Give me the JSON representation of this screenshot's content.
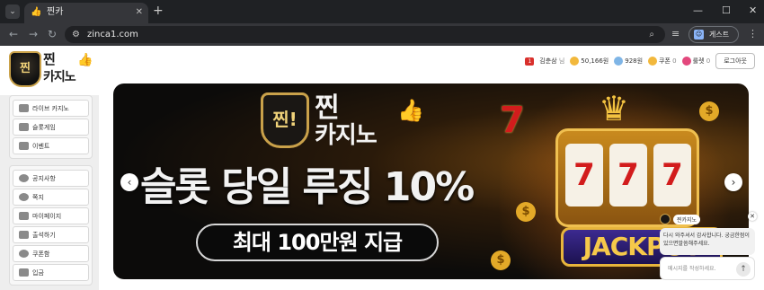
{
  "browser": {
    "tab_title": "찐카",
    "tab_menu_icon": "chevron-down-icon",
    "url": "zinca1.com",
    "guest_label": "게스트(4)",
    "window_controls": [
      "—",
      "☐",
      "✕"
    ]
  },
  "site": {
    "logo_main": "찐",
    "logo_text": "카지노",
    "logo_badge": "찐!",
    "userbar": {
      "level": "1",
      "username": "김춘삼",
      "suffix": "님",
      "money": "50,166원",
      "points": "928원",
      "coupon_label": "쿠폰",
      "coupon_count": "0",
      "roulette_label": "룰렛",
      "roulette_count": "0",
      "logout": "로그아웃"
    },
    "menu_group_1": [
      "라이브 카지노",
      "슬롯게임",
      "이벤트"
    ],
    "menu_group_2": [
      "공지사항",
      "쪽지",
      "마이페이지",
      "출석하기",
      "쿠폰함",
      "입금"
    ],
    "banner": {
      "badge": "찐!",
      "logo_line1": "찐",
      "logo_line2": "카지노",
      "headline": "슬롯 당일 루징 10%",
      "subline": "최대 100만원 지급",
      "jackpot": "JACKPOT",
      "prev_icon": "‹",
      "next_icon": "›"
    },
    "chat": {
      "name": "찐카지노",
      "message": "다시 와주셔서 감사합니다. 궁금한점이 있으면말씀해주세요.",
      "placeholder": "메시지를 작성하세요.",
      "close": "✕",
      "send": "↑"
    }
  },
  "colors": {
    "accent_red": "#d9302c",
    "browser_dark": "#1f2124",
    "gold": "#c9a14a"
  }
}
